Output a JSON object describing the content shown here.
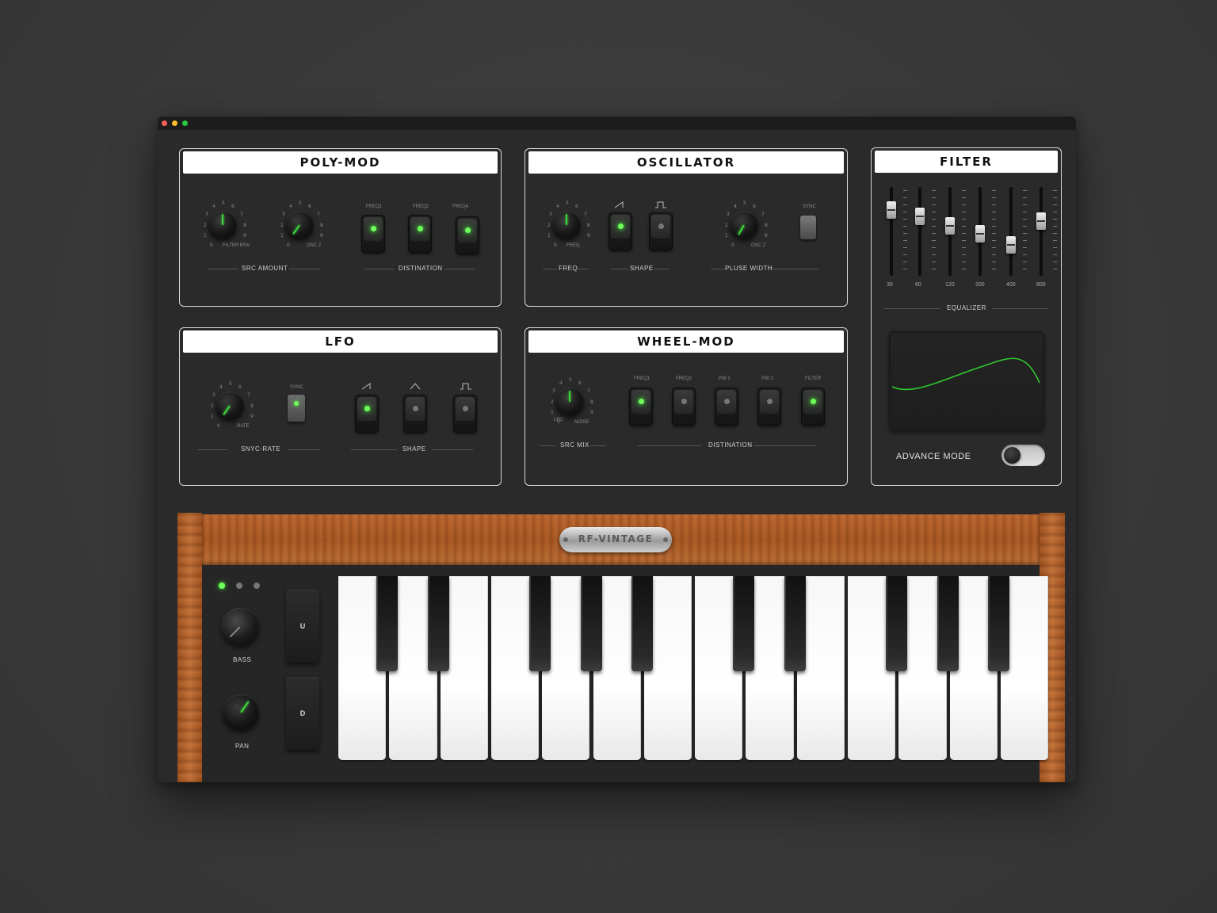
{
  "colors": {
    "accent": "#3dd63d",
    "panel_border": "#d9d9d9",
    "window_bg": "#2a2a2a"
  },
  "window": {
    "traffic_lights": [
      "close",
      "minimize",
      "maximize"
    ]
  },
  "poly_mod": {
    "title": "POLY-MOD",
    "knob1_label": "FILTER ENV",
    "knob2_label": "OSC 2",
    "section_left": "SRC AMOUNT",
    "switch_labels": [
      "FREQ1",
      "FREQ2",
      "FREQ4"
    ],
    "section_right": "DISTINATION"
  },
  "oscillator": {
    "title": "OSCILLATOR",
    "knob1_label": "FREQ",
    "knob2_label": "OSC 2",
    "sync_label": "SYNC",
    "section_freq": "FREQ",
    "section_shape": "SHAPE",
    "section_pw": "PLUSE WIDTH"
  },
  "filter": {
    "title": "FILTER",
    "eq_bands": [
      "30",
      "60",
      "120",
      "200",
      "400",
      "800"
    ],
    "eq_label": "EQUALIZER",
    "advance_mode_label": "ADVANCE MODE",
    "advance_mode_on": false
  },
  "lfo": {
    "title": "LFO",
    "knob_label": "RATE",
    "sync_label": "SYNC",
    "section_rate": "SNYC-RATE",
    "section_shape": "SHAPE"
  },
  "wheel_mod": {
    "title": "WHEEL-MOD",
    "knob_left": "LFO",
    "knob_right": "NOISE",
    "switch_labels": [
      "FREQ1",
      "FREQ2",
      "PW 1",
      "PW 2",
      "FILTER"
    ],
    "section_src": "SRC MIX",
    "section_dest": "DISTINATION"
  },
  "keyboard": {
    "brand": "RF-VINTAGE",
    "bass_label": "BASS",
    "pan_label": "PAN",
    "up_label": "U",
    "down_label": "D"
  },
  "knob_scale": [
    "0",
    "1",
    "2",
    "3",
    "4",
    "5",
    "6",
    "7",
    "8",
    "9"
  ]
}
